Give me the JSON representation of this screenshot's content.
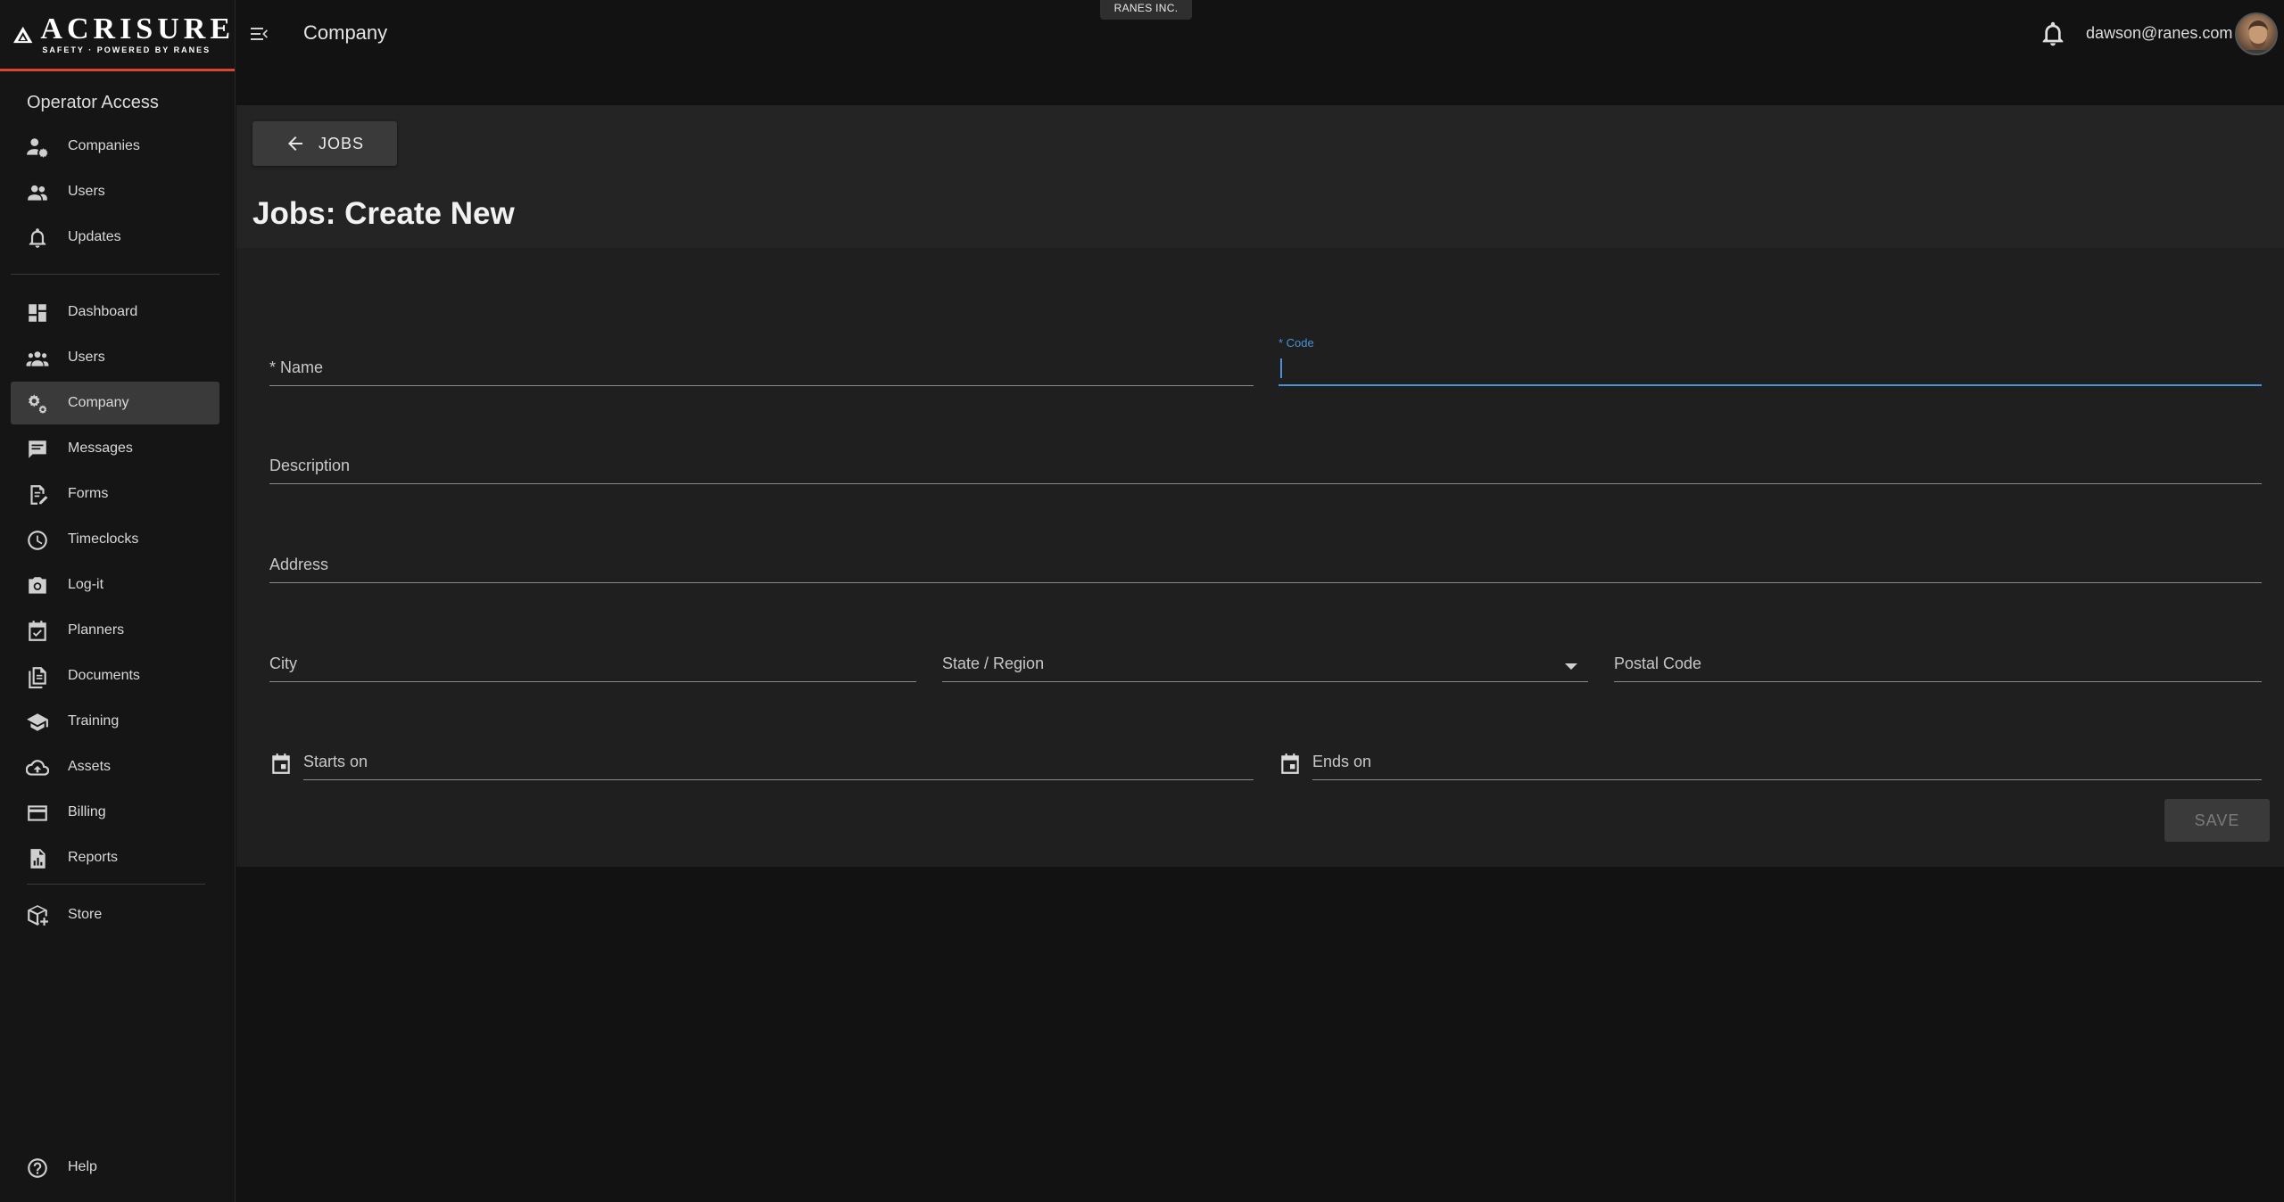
{
  "brand": {
    "name": "ACRISURE",
    "tagline": "SAFETY · POWERED BY RANES"
  },
  "sidebar": {
    "operator_title": "Operator Access",
    "operator_items": [
      {
        "label": "Companies",
        "icon": "user-gear-icon"
      },
      {
        "label": "Users",
        "icon": "users-icon"
      },
      {
        "label": "Updates",
        "icon": "bell-icon"
      }
    ],
    "items": [
      {
        "label": "Dashboard",
        "icon": "dashboard-icon"
      },
      {
        "label": "Users",
        "icon": "group-icon"
      },
      {
        "label": "Company",
        "icon": "gears-icon",
        "active": true
      },
      {
        "label": "Messages",
        "icon": "message-icon"
      },
      {
        "label": "Forms",
        "icon": "form-edit-icon"
      },
      {
        "label": "Timeclocks",
        "icon": "clock-icon"
      },
      {
        "label": "Log-it",
        "icon": "camera-icon"
      },
      {
        "label": "Planners",
        "icon": "calendar-check-icon"
      },
      {
        "label": "Documents",
        "icon": "documents-icon"
      },
      {
        "label": "Training",
        "icon": "graduation-cap-icon"
      },
      {
        "label": "Assets",
        "icon": "cloud-icon"
      },
      {
        "label": "Billing",
        "icon": "credit-card-icon"
      },
      {
        "label": "Reports",
        "icon": "report-icon"
      }
    ],
    "store": {
      "label": "Store",
      "icon": "box-add-icon"
    },
    "help": {
      "label": "Help",
      "icon": "help-icon"
    }
  },
  "topbar": {
    "title": "Company",
    "tenant": "RANES INC.",
    "user_email": "dawson@ranes.com"
  },
  "page": {
    "back_label": "JOBS",
    "title": "Jobs: Create New"
  },
  "form": {
    "name_label": "* Name",
    "code_label": "* Code",
    "description_label": "Description",
    "address_label": "Address",
    "city_label": "City",
    "state_label": "State / Region",
    "postal_label": "Postal Code",
    "starts_label": "Starts on",
    "ends_label": "Ends on",
    "save_label": "SAVE"
  },
  "colors": {
    "accent_red": "#d9452f",
    "focus_blue": "#4a90d9",
    "active_nav": "#3a3a3a"
  }
}
